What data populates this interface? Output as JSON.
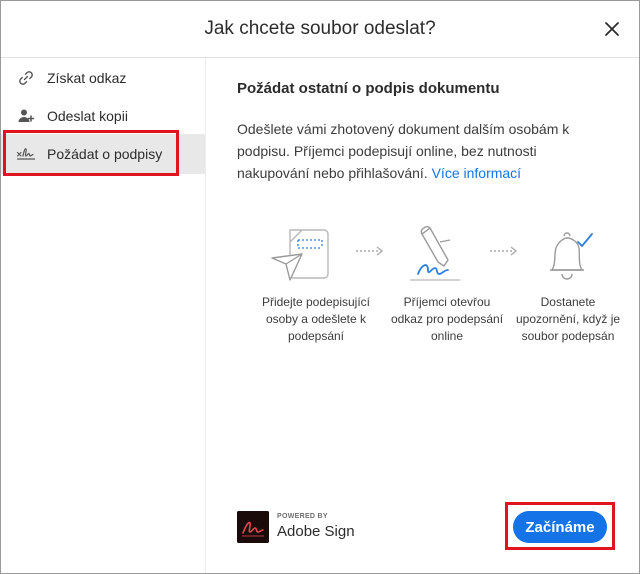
{
  "dialog": {
    "title": "Jak chcete soubor odeslat?"
  },
  "sidebar": {
    "items": [
      {
        "label": "Získat odkaz",
        "icon": "link-icon"
      },
      {
        "label": "Odeslat kopii",
        "icon": "add-person-icon"
      },
      {
        "label": "Požádat o podpisy",
        "icon": "signature-icon",
        "active": true
      }
    ]
  },
  "main": {
    "heading": "Požádat ostatní o podpis dokumentu",
    "description": "Odešlete vámi zhotovený dokument dalším osobám k podpisu. Příjemci podepisují online, bez nutnosti nakupování nebo přihlašování.",
    "more_info_link": "Více informací",
    "steps": [
      {
        "icon": "send-document-icon",
        "text": "Přidejte podepisující osoby a odešlete k podepsání"
      },
      {
        "icon": "sign-pen-icon",
        "text": "Příjemci otevřou odkaz pro podepsání online"
      },
      {
        "icon": "bell-check-icon",
        "text": "Dostanete upozornění, když je soubor podepsán"
      }
    ]
  },
  "footer": {
    "powered_by": "POWERED BY",
    "brand_name": "Adobe Sign",
    "start_button": "Začínáme"
  },
  "colors": {
    "accent": "#1473e6",
    "highlight": "#e0141e",
    "active_bg": "#e8e8e8"
  }
}
